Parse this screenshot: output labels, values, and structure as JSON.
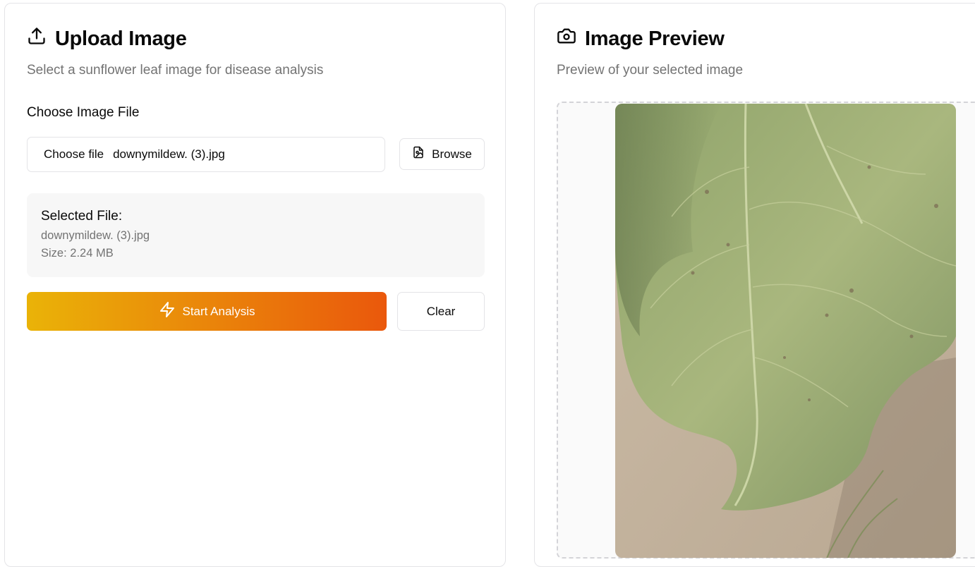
{
  "upload": {
    "title": "Upload Image",
    "description": "Select a sunflower leaf image for disease analysis",
    "field_label": "Choose Image File",
    "file_input": {
      "choose_label": "Choose file",
      "file_name": "downymildew. (3).jpg"
    },
    "browse_label": "Browse",
    "selected": {
      "title": "Selected File:",
      "file_name": "downymildew. (3).jpg",
      "size": "Size: 2.24 MB"
    },
    "analyze_label": "Start Analysis",
    "clear_label": "Clear"
  },
  "preview": {
    "title": "Image Preview",
    "description": "Preview of your selected image",
    "image_subject": "sunflower-leaf-photo"
  },
  "icons": {
    "upload": "upload-icon",
    "browse": "file-image-icon",
    "analyze": "zap-icon",
    "preview": "camera-icon"
  },
  "colors": {
    "gradient_start": "#eab308",
    "gradient_end": "#ea580c",
    "muted_text": "#737373",
    "border": "#e4e4e7"
  }
}
